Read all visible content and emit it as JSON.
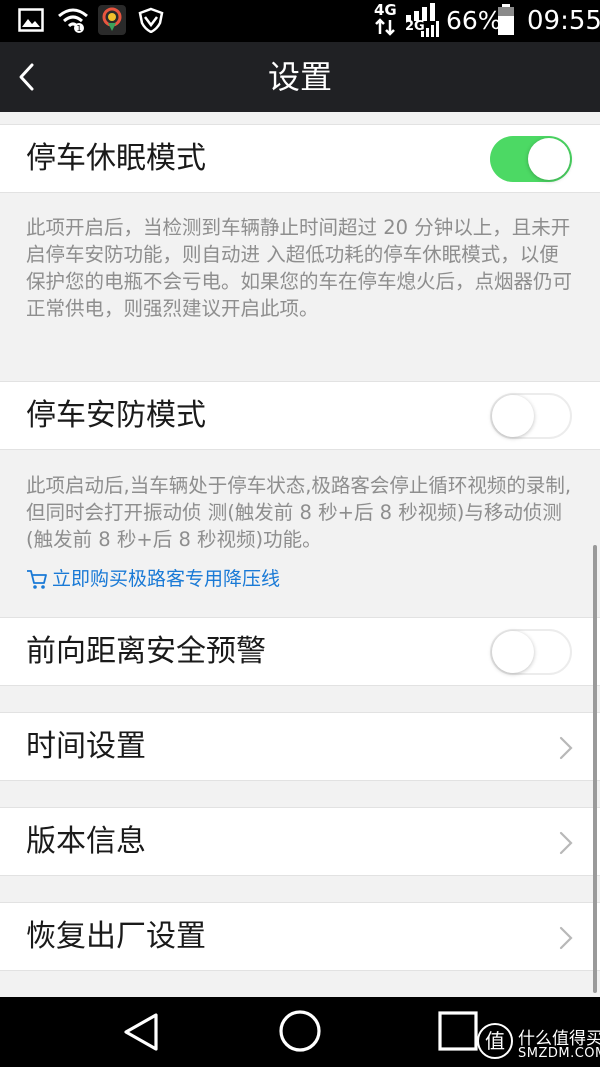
{
  "status_bar": {
    "signal_top": "4G",
    "signal_bottom": "2G",
    "battery_percent": "66%",
    "time": "09:55",
    "icons": [
      "image-icon",
      "wifi-icon",
      "map-pin-app-icon",
      "shield-vpn-icon",
      "data-arrows-icon",
      "signal-bars-icon",
      "battery-icon"
    ]
  },
  "header": {
    "title": "设置",
    "back_icon": "back-chevron-icon"
  },
  "settings": {
    "parking_sleep": {
      "label": "停车休眠模式",
      "enabled": true,
      "description": "此项开启后，当检测到车辆静止时间超过 20 分钟以上，且未开启停车安防功能，则自动进 入超低功耗的停车休眠模式，以便保护您的电瓶不会亏电。如果您的车在停车熄火后，点烟器仍可正常供电，则强烈建议开启此项。"
    },
    "parking_security": {
      "label": "停车安防模式",
      "enabled": false,
      "description": "此项启动后,当车辆处于停车状态,极路客会停止循环视频的录制,但同时会打开振动侦 测(触发前 8 秒+后 8 秒视频)与移动侦测(触发前 8 秒+后 8 秒视频)功能。",
      "link_text": "立即购买极路客专用降压线",
      "link_icon": "cart-icon"
    },
    "forward_distance": {
      "label": "前向距离安全预警",
      "enabled": false
    },
    "time_settings": {
      "label": "时间设置"
    },
    "version_info": {
      "label": "版本信息"
    },
    "factory_reset": {
      "label": "恢复出厂设置"
    }
  },
  "colors": {
    "toggle_on": "#4cd964",
    "link": "#1a7ad6",
    "title_bar": "#202124",
    "background": "#f2f2f2"
  },
  "nav_bar": {
    "icons": [
      "back-triangle-icon",
      "home-circle-icon",
      "recents-square-icon"
    ]
  },
  "watermark": {
    "line1": "什么值得买",
    "line2": "SMZDM.COM",
    "logo_char": "值"
  }
}
